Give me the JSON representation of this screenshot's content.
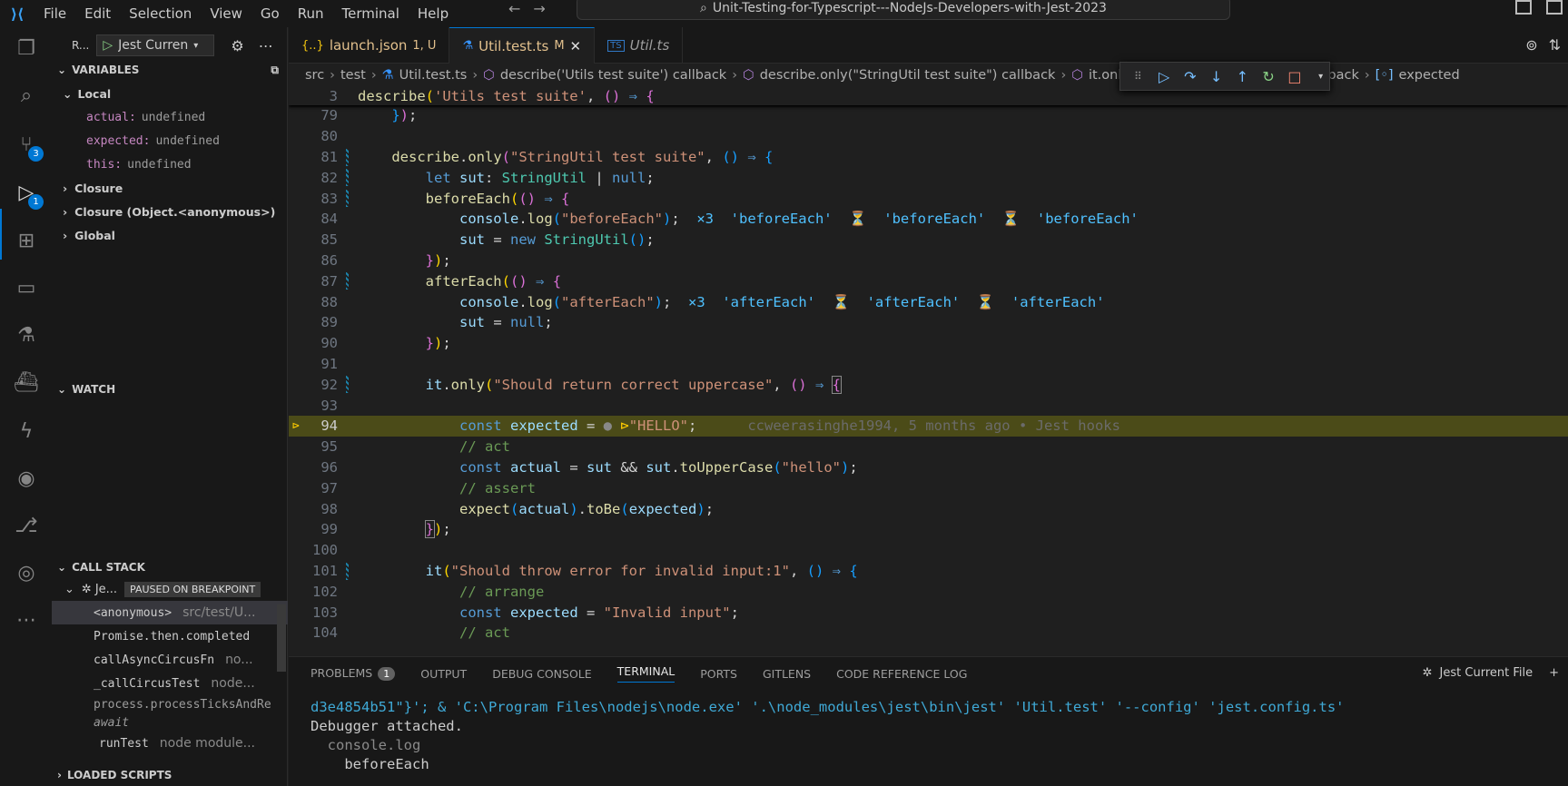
{
  "titlebar": {
    "menu": [
      "File",
      "Edit",
      "Selection",
      "View",
      "Go",
      "Run",
      "Terminal",
      "Help"
    ],
    "search_text": "Unit-Testing-for-Typescript---NodeJs-Developers-with-Jest-2023"
  },
  "activity_bar": {
    "scm_badge": "3",
    "debug_badge": "1"
  },
  "debug_toolbar": {
    "run_label": "R...",
    "config_name": "Jest Curren"
  },
  "variables": {
    "header": "VARIABLES",
    "local_label": "Local",
    "locals": [
      {
        "name": "actual:",
        "value": "undefined"
      },
      {
        "name": "expected:",
        "value": "undefined"
      },
      {
        "name": "this:",
        "value": "undefined"
      }
    ],
    "scopes": [
      "Closure",
      "Closure (Object.<anonymous>)",
      "Global"
    ]
  },
  "watch": {
    "header": "WATCH"
  },
  "call_stack": {
    "header": "CALL STACK",
    "thread_name": "Je...",
    "paused_label": "PAUSED ON BREAKPOINT",
    "frames": [
      {
        "fn": "<anonymous>",
        "loc": "src/test/U..."
      },
      {
        "fn": "Promise.then.completed",
        "loc": ""
      },
      {
        "fn": "callAsyncCircusFn",
        "loc": "no..."
      },
      {
        "fn": "_callCircusTest",
        "loc": "node..."
      },
      {
        "fn": "process.processTicksAndRe",
        "loc": ""
      },
      {
        "fn": "await",
        "loc": ""
      },
      {
        "fn": "runTest",
        "loc": "node module..."
      }
    ]
  },
  "loaded_scripts": {
    "header": "LOADED SCRIPTS"
  },
  "tabs": [
    {
      "label": "launch.json",
      "meta": "1, U",
      "icon": "{..}"
    },
    {
      "label": "Util.test.ts",
      "meta": "M",
      "icon": "⚗"
    },
    {
      "label": "Util.ts",
      "meta": "",
      "icon": "TS"
    }
  ],
  "breadcrumb": [
    "src",
    "test",
    "Util.test.ts",
    "describe('Utils test suite') callback",
    "describe.only(\"StringUtil test suite\") callback",
    "it.only(\"S",
    "callback",
    "expected"
  ],
  "code": {
    "sticky_line_number": "3",
    "blame": "ccweerasinghe1994, 5 months ago • Jest hooks",
    "line_numbers": [
      "79",
      "80",
      "81",
      "82",
      "83",
      "84",
      "85",
      "86",
      "87",
      "88",
      "89",
      "90",
      "91",
      "92",
      "93",
      "94",
      "95",
      "96",
      "97",
      "98",
      "99",
      "100",
      "101",
      "102",
      "103",
      "104"
    ],
    "inline_before": "×3  'beforeEach'  ⏳  'beforeEach'  ⏳  'beforeEach'",
    "inline_after": "×3  'afterEach'  ⏳  'afterEach'  ⏳  'afterEach'"
  },
  "panel": {
    "tabs": [
      "PROBLEMS",
      "OUTPUT",
      "DEBUG CONSOLE",
      "TERMINAL",
      "PORTS",
      "GITLENS",
      "CODE REFERENCE LOG"
    ],
    "problems_count": "1",
    "active_tab": "TERMINAL",
    "right_label": "Jest Current File",
    "terminal_lines": [
      "d3e4854b51\"}'; & 'C:\\Program Files\\nodejs\\node.exe' '.\\node_modules\\jest\\bin\\jest' 'Util.test' '--config' 'jest.config.ts'",
      "Debugger attached.",
      "  console.log",
      "    beforeEach"
    ]
  },
  "colors": {
    "accent": "#0078d4",
    "current_line": "#4b4b18",
    "breakpoint": "#ffcc00"
  }
}
